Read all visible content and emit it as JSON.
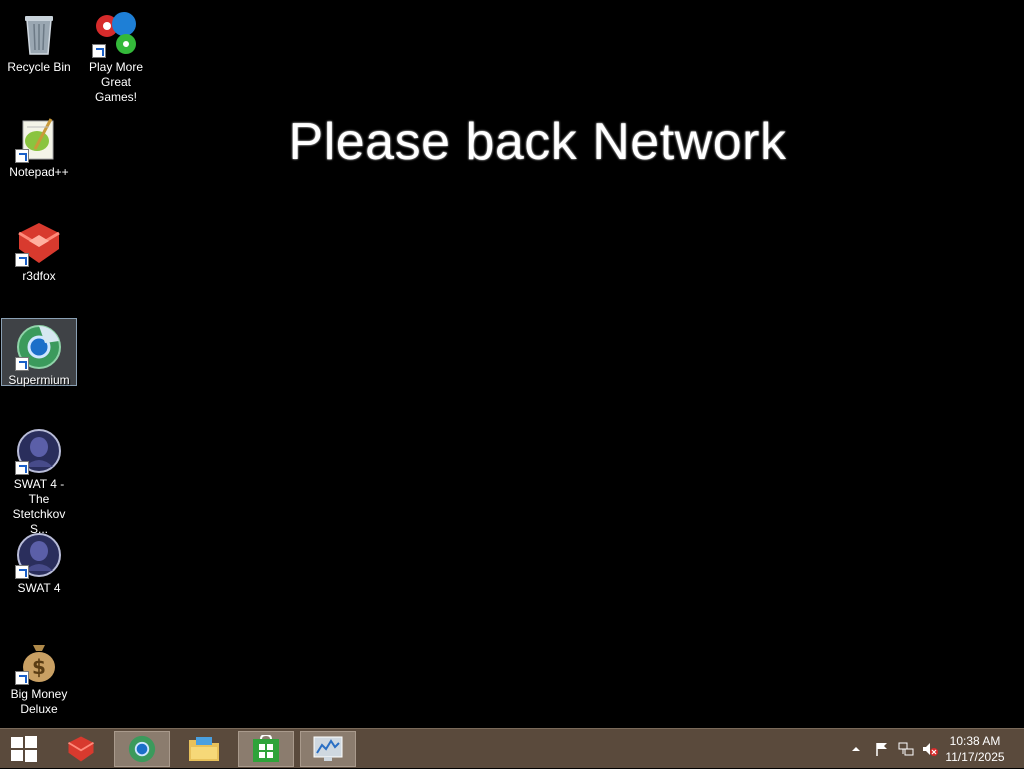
{
  "banner": {
    "text": "Please back Network"
  },
  "desktop_icons": [
    {
      "label": "Recycle Bin"
    },
    {
      "label": "Play More Great Games!"
    },
    {
      "label": "Notepad++"
    },
    {
      "label": "r3dfox"
    },
    {
      "label": "Supermium"
    },
    {
      "label": "SWAT 4 - The Stetchkov S..."
    },
    {
      "label": "SWAT 4"
    },
    {
      "label": "Big Money Deluxe"
    }
  ],
  "taskbar": {
    "items": [
      "start-button",
      "r3dfox",
      "supermium",
      "file-explorer",
      "store",
      "performance-monitor"
    ],
    "clock": {
      "time": "10:38 AM",
      "date": "11/17/2025"
    }
  },
  "colors": {
    "taskbar": "#5a4a3c",
    "selection": "#8aa0b4"
  }
}
